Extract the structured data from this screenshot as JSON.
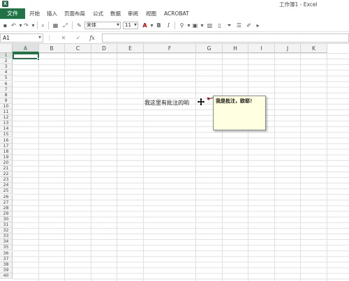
{
  "window": {
    "title": "工作簿1 - Excel",
    "app_icon": "excel-icon"
  },
  "menu": {
    "file": "文件",
    "items": [
      "开始",
      "插入",
      "页面布局",
      "公式",
      "数据",
      "审阅",
      "视图",
      "ACROBAT"
    ]
  },
  "toolbar": {
    "font_name": "宋体",
    "font_size": "11",
    "bold": "B",
    "italic": "I"
  },
  "formula_bar": {
    "name_box": "A1",
    "fx": "fx",
    "cancel": "✕",
    "enter": "✓",
    "value": ""
  },
  "columns": [
    "A",
    "B",
    "C",
    "D",
    "E",
    "F",
    "G",
    "H",
    "I",
    "J",
    "K"
  ],
  "rows": [
    "1",
    "2",
    "3",
    "4",
    "5",
    "6",
    "7",
    "8",
    "9",
    "10",
    "11",
    "12",
    "13",
    "14",
    "15",
    "16",
    "17",
    "18",
    "19",
    "20",
    "21",
    "22",
    "23",
    "24",
    "25",
    "26",
    "27",
    "28",
    "29",
    "30",
    "31",
    "32",
    "33",
    "34",
    "35",
    "36",
    "37",
    "38",
    "39",
    "40"
  ],
  "sheet": {
    "cell_text": "我这里有批注的哟",
    "comment_text": "我是批注，欧耶！"
  },
  "colors": {
    "accent": "#217346",
    "comment_bg": "#ffffe1",
    "comment_marker": "#cc0000"
  }
}
